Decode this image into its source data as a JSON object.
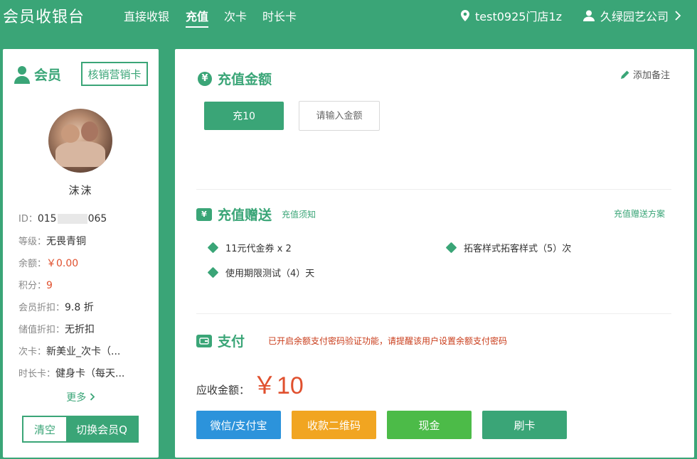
{
  "header": {
    "app_title": "会员收银台",
    "nav": [
      "直接收银",
      "充值",
      "次卡",
      "时长卡"
    ],
    "active_nav": "充值",
    "store": "test0925门店1z",
    "company": "久绿园艺公司"
  },
  "member": {
    "section_title": "会员",
    "redeem_label": "核销营销卡",
    "name": "沫沫",
    "id_label": "ID：",
    "id_prefix": "015",
    "id_suffix": "065",
    "level_label": "等级：",
    "level": "无畏青铜",
    "balance_label": "余额：",
    "balance": "￥0.00",
    "points_label": "积分：",
    "points": "9",
    "discount_label": "会员折扣：",
    "discount": "9.8 折",
    "stored_discount_label": "储值折扣：",
    "stored_discount": "无折扣",
    "count_card_label": "次卡：",
    "count_card": "新美业_次卡（...",
    "time_card_label": "时长卡：",
    "time_card": "健身卡（每天...",
    "more_label": "更多",
    "clear_label": "清空",
    "switch_label": "切换会员Q"
  },
  "recharge": {
    "title": "充值金额",
    "add_note": "添加备注",
    "preset_label": "充10",
    "input_placeholder": "请输入金额"
  },
  "gift": {
    "title": "充值赠送",
    "notice_link": "充值须知",
    "plan_link": "充值赠送方案",
    "items": [
      "11元代金券 x 2",
      "拓客样式拓客样式（5）次",
      "使用期限测试（4）天"
    ]
  },
  "payment": {
    "title": "支付",
    "warning": "已开启余额支付密码验证功能，请提醒该用户设置余额支付密码",
    "receivable_label": "应收金额：",
    "receivable_amount": "￥10",
    "methods": [
      "微信/支付宝",
      "收款二维码",
      "现金",
      "刷卡"
    ]
  },
  "colors": {
    "brand_green": "#3aa577",
    "wechat_blue": "#2c93db",
    "qr_orange": "#f1a521",
    "cash_green": "#4cbb48",
    "card_green": "#3aa577",
    "price_red": "#e0502e"
  }
}
